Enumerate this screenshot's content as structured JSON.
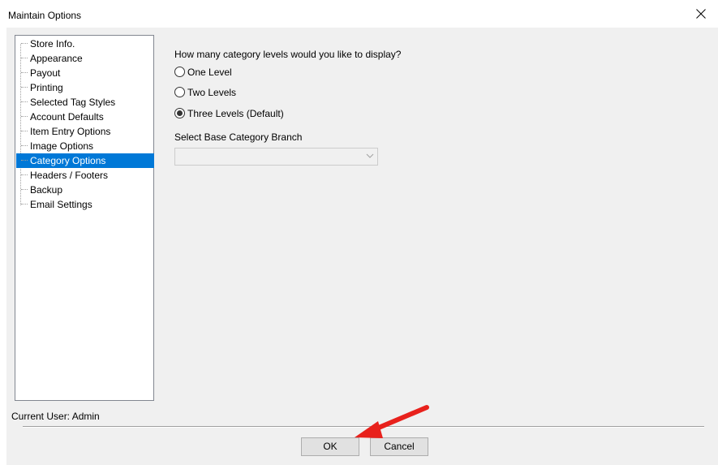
{
  "window": {
    "title": "Maintain Options"
  },
  "tree": {
    "items": [
      {
        "label": "Store Info."
      },
      {
        "label": "Appearance"
      },
      {
        "label": "Payout"
      },
      {
        "label": "Printing"
      },
      {
        "label": "Selected Tag Styles"
      },
      {
        "label": "Account Defaults"
      },
      {
        "label": "Item Entry Options"
      },
      {
        "label": "Image Options"
      },
      {
        "label": "Category Options",
        "selected": true
      },
      {
        "label": "Headers / Footers"
      },
      {
        "label": "Backup"
      },
      {
        "label": "Email Settings"
      }
    ]
  },
  "category_options": {
    "question": "How many category levels would you like to display?",
    "levels": [
      {
        "label": "One Level",
        "checked": false
      },
      {
        "label": "Two Levels",
        "checked": false
      },
      {
        "label": "Three Levels (Default)",
        "checked": true
      }
    ],
    "branch_label": "Select Base Category Branch",
    "branch_value": ""
  },
  "status": {
    "current_user": "Current User: Admin"
  },
  "buttons": {
    "ok": "OK",
    "cancel": "Cancel"
  },
  "colors": {
    "selection": "#0078d7",
    "annotation_arrow": "#e8211c"
  }
}
